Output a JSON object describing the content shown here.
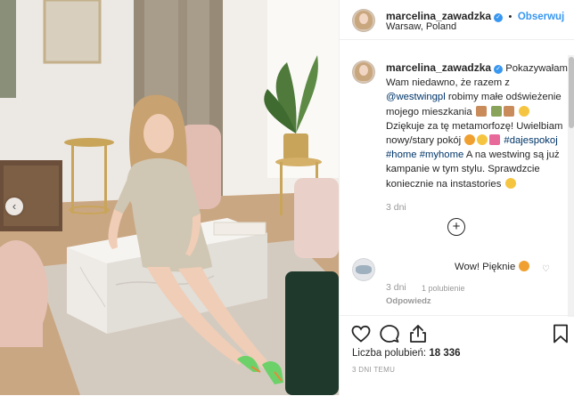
{
  "post": {
    "username": "marcelina_zawadzka",
    "follow_label": "Obserwuj",
    "separator": "•",
    "location": "Warsaw, Poland"
  },
  "caption": {
    "username": "marcelina_zawadzka",
    "text_1": "Pokazywałam Wam niedawno, że razem z",
    "mention": "@westwingpl",
    "text_2": "robimy małe odświeżenie mojego mieszkania",
    "text_3": "Dziękuje za tę metamorfozę! Uwielbiam nowy/stary pokój",
    "hashtag_1": "#dajespokoj",
    "hashtag_2": "#home",
    "hashtag_3": "#myhome",
    "text_4": "A na westwing są już kampanie w tym stylu. Sprawdzcie koniecznie na instastories",
    "time": "3 dni"
  },
  "comment": {
    "text": "Wow! Pięknie",
    "time": "3 dni",
    "likes": "1 polubienie",
    "reply_label": "Odpowiedz"
  },
  "stats": {
    "likes_label": "Liczba polubień:",
    "likes_count": "18 336",
    "posted_ago": "3 DNI TEMU"
  },
  "icons": {
    "like": "heart-icon",
    "comment": "comment-icon",
    "share": "share-icon",
    "save": "bookmark-icon",
    "verified": "verified-badge-icon",
    "load_more": "plus-circle-icon",
    "prev": "chevron-left-icon"
  },
  "colors": {
    "link": "#3897f0",
    "text": "#262626",
    "muted": "#999999",
    "verified": "#3897f0"
  }
}
